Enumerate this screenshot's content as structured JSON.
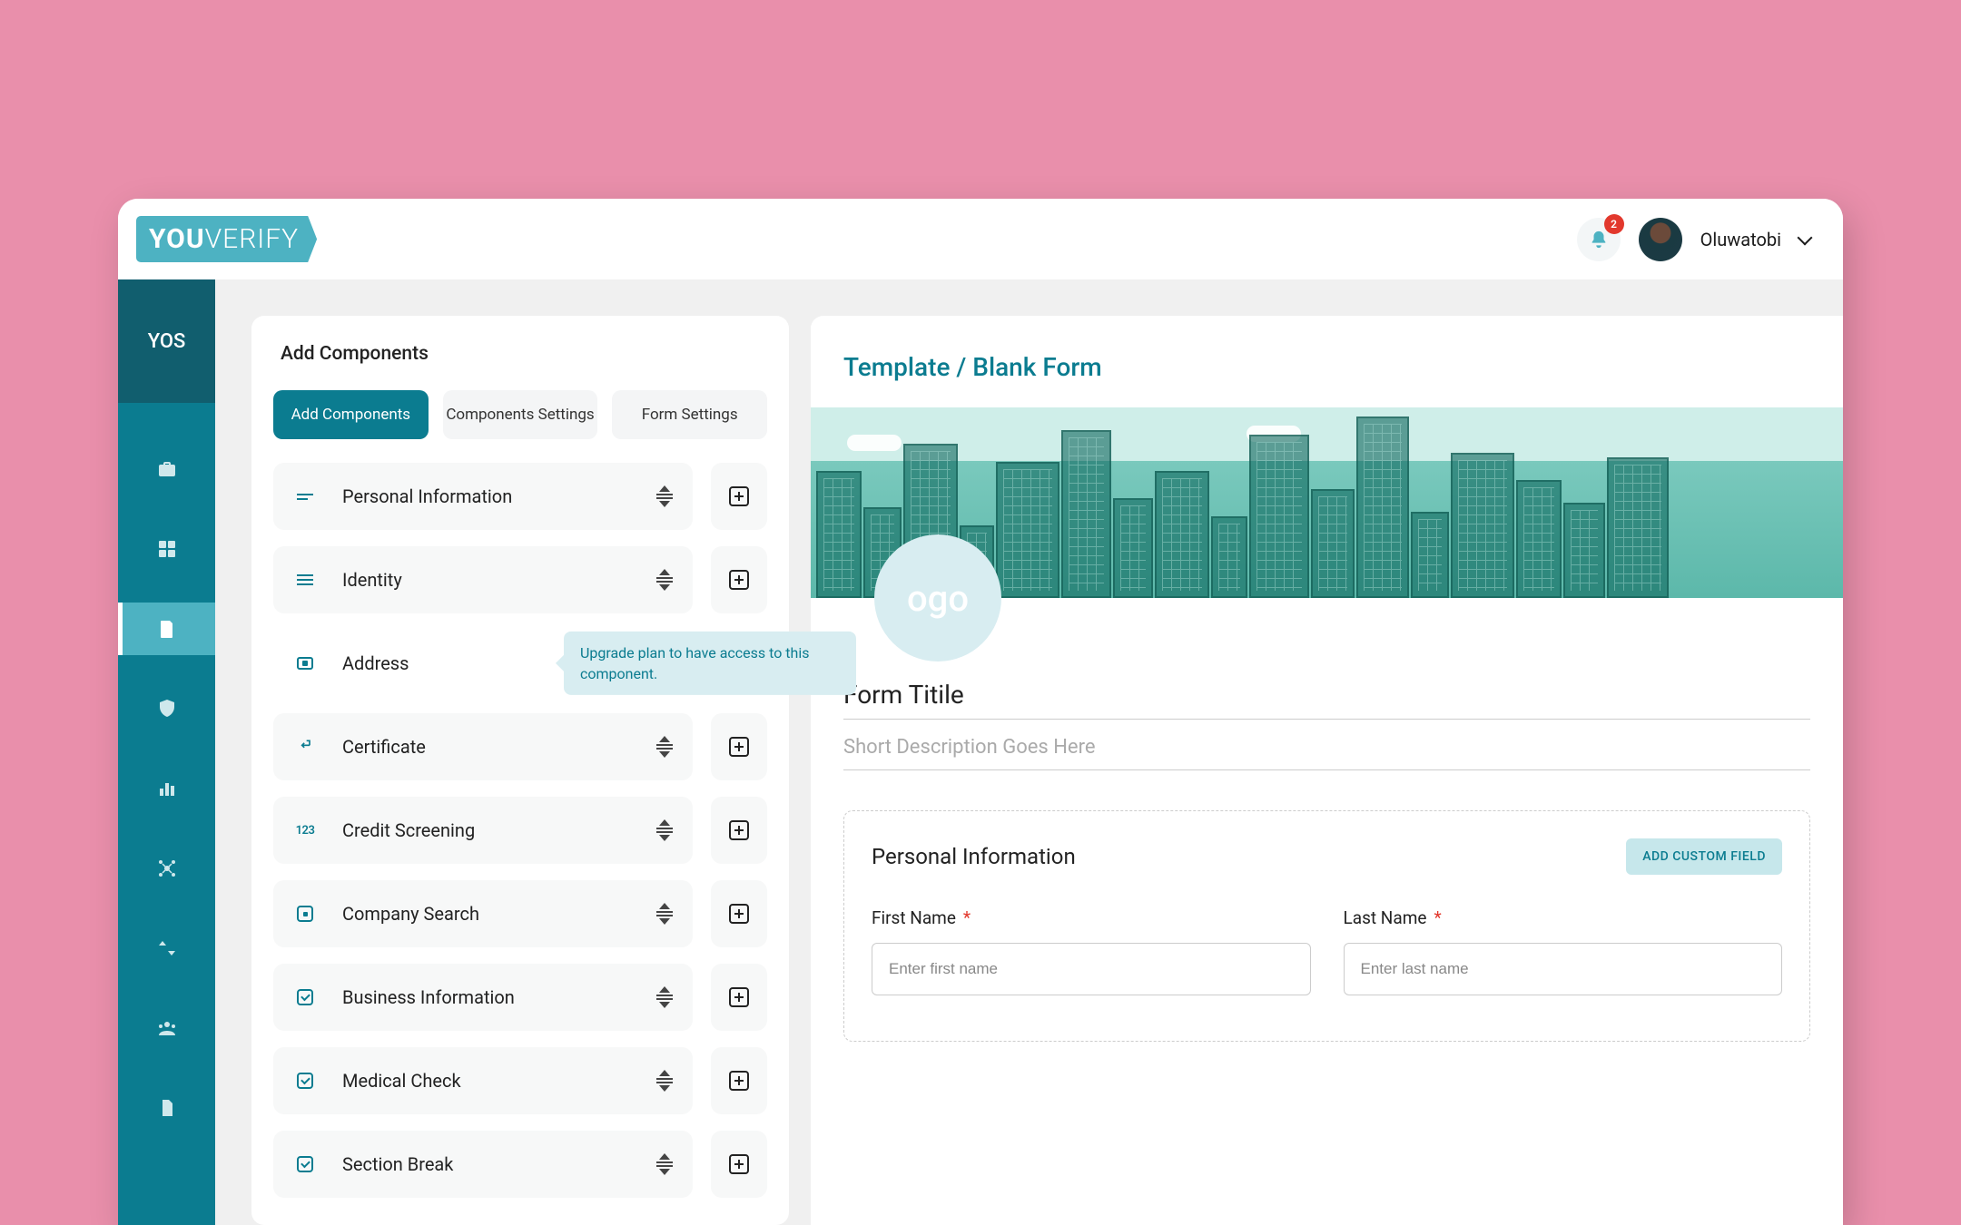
{
  "brand": {
    "part1": "YOU",
    "part2": "VERIFY"
  },
  "notifications": {
    "count": "2"
  },
  "user": {
    "name": "Oluwatobi"
  },
  "sidebar": {
    "top_label": "YOS"
  },
  "panel": {
    "title": "Add Components",
    "tabs": [
      "Add Components",
      "Components Settings",
      "Form Settings"
    ]
  },
  "components": [
    {
      "label": "Personal Information",
      "icon": "text-short",
      "locked": false
    },
    {
      "label": "Identity",
      "icon": "text-long",
      "locked": false
    },
    {
      "label": "Address",
      "icon": "card",
      "locked": true
    },
    {
      "label": "Certificate",
      "icon": "ret-arrow",
      "locked": false
    },
    {
      "label": "Credit Screening",
      "icon": "num123",
      "locked": false
    },
    {
      "label": "Company Search",
      "icon": "dot-box",
      "locked": false
    },
    {
      "label": "Business Information",
      "icon": "check-box",
      "locked": false
    },
    {
      "label": "Medical Check",
      "icon": "check-box",
      "locked": false
    },
    {
      "label": "Section Break",
      "icon": "check-box",
      "locked": false
    }
  ],
  "tooltip": {
    "text": "Upgrade plan to have access to this component."
  },
  "form": {
    "breadcrumb": "Template / Blank Form",
    "logo_text": "ogo",
    "title": "Form Titile",
    "description": "Short Description Goes Here",
    "section_title": "Personal Information",
    "add_field_label": "ADD CUSTOM FIELD",
    "fields": [
      {
        "label": "First Name",
        "placeholder": "Enter first name"
      },
      {
        "label": "Last Name",
        "placeholder": "Enter last name"
      }
    ]
  }
}
